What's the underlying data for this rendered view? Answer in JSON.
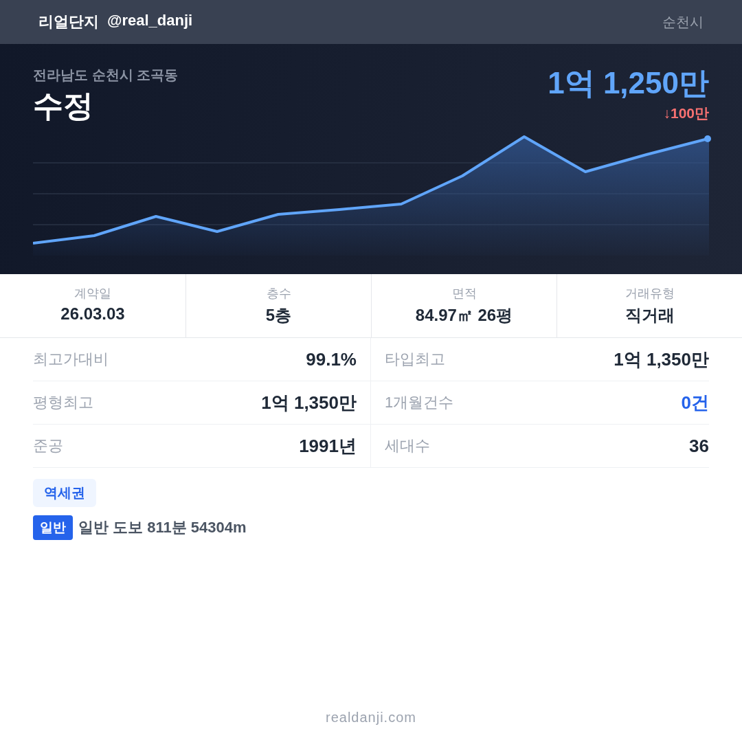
{
  "header": {
    "brand": "리얼단지",
    "handle": "@real_danji",
    "city": "순천시"
  },
  "hero": {
    "address": "전라남도 순천시 조곡동",
    "name": "수정",
    "price": "1억 1,250만",
    "change": "↓100만"
  },
  "stats": [
    {
      "label": "계약일",
      "value": "26.03.03"
    },
    {
      "label": "층수",
      "value": "5층"
    },
    {
      "label": "면적",
      "value": "84.97㎡ 26평"
    },
    {
      "label": "거래유형",
      "value": "직거래"
    }
  ],
  "metrics": [
    {
      "label": "최고가대비",
      "value": "99.1%",
      "emphasis": false
    },
    {
      "label": "타입최고",
      "value": "1억 1,350만",
      "emphasis": false
    },
    {
      "label": "평형최고",
      "value": "1억 1,350만",
      "emphasis": false
    },
    {
      "label": "1개월건수",
      "value": "0건",
      "emphasis": true
    },
    {
      "label": "준공",
      "value": "1991년",
      "emphasis": false
    },
    {
      "label": "세대수",
      "value": "36",
      "emphasis": false
    }
  ],
  "tag": "역세권",
  "station": {
    "badge": "일반",
    "text": "일반 도보 811분 54304m"
  },
  "footer": "realdanji.com"
}
